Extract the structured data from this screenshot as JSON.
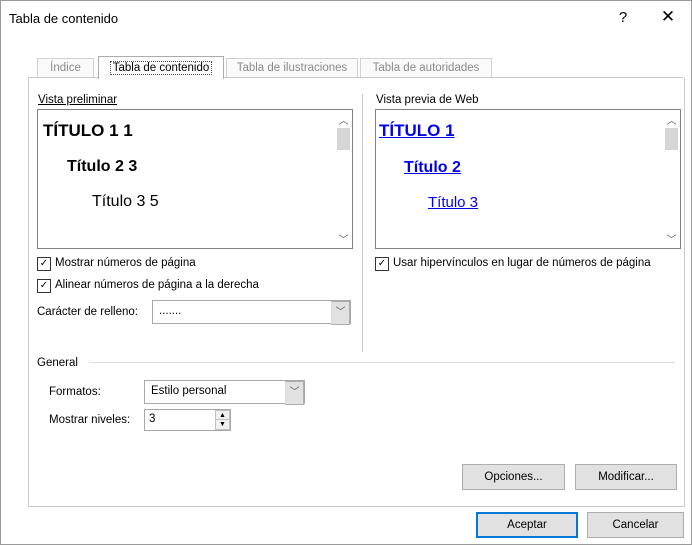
{
  "window": {
    "title": "Tabla de contenido",
    "help": "?",
    "close": "✕"
  },
  "tabs": [
    {
      "label": "Índice"
    },
    {
      "label": "Tabla de contenido"
    },
    {
      "label": "Tabla de ilustraciones"
    },
    {
      "label": "Tabla de autoridades"
    }
  ],
  "print_preview": {
    "label": "Vista preliminar",
    "h1": "TÍTULO 1 1",
    "h2": "Título 2 3",
    "h3": "Título 3 5"
  },
  "web_preview": {
    "label": "Vista previa de Web",
    "h1": "TÍTULO 1",
    "h2": "Título 2",
    "h3": "Título 3"
  },
  "options": {
    "show_page_numbers": {
      "label": "Mostrar números de página",
      "checked": true
    },
    "right_align": {
      "label": "Alinear números de página a la derecha",
      "checked": true
    },
    "use_hyperlinks": {
      "label": "Usar hipervínculos en lugar de números de página",
      "checked": true
    },
    "tab_leader": {
      "label": "Carácter de relleno:",
      "value": "......."
    }
  },
  "general": {
    "heading": "General",
    "formats_label": "Formatos:",
    "formats_value": "Estilo personal",
    "levels_label": "Mostrar niveles:",
    "levels_value": "3"
  },
  "buttons": {
    "options": "Opciones...",
    "modify": "Modificar...",
    "ok": "Aceptar",
    "cancel": "Cancelar"
  },
  "colors": {
    "link": "#0000ee",
    "accent": "#0078d7"
  }
}
